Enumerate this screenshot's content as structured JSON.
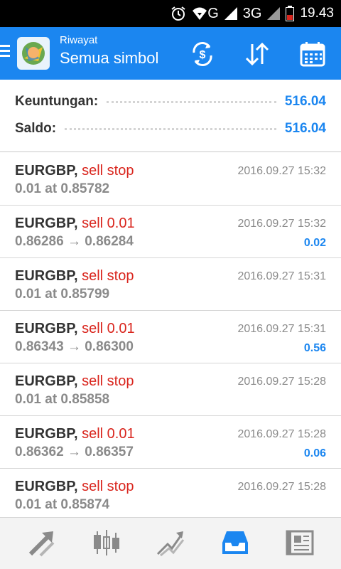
{
  "status_bar": {
    "network_label": "G",
    "network2_label": "3G",
    "time": "19.43"
  },
  "header": {
    "subtitle": "Riwayat",
    "title": "Semua simbol",
    "actions": [
      "exchange-icon",
      "sort-icon",
      "calendar-icon"
    ]
  },
  "summary": {
    "profit_label": "Keuntungan:",
    "profit_value": "516.04",
    "balance_label": "Saldo:",
    "balance_value": "516.04"
  },
  "history": [
    {
      "symbol": "EURGBP,",
      "type": "sell stop",
      "detail": "0.01 at 0.85782",
      "time": "2016.09.27 15:32",
      "profit": ""
    },
    {
      "symbol": "EURGBP,",
      "type": "sell 0.01",
      "detail": "0.86286 → 0.86284",
      "time": "2016.09.27 15:32",
      "profit": "0.02"
    },
    {
      "symbol": "EURGBP,",
      "type": "sell stop",
      "detail": "0.01 at 0.85799",
      "time": "2016.09.27 15:31",
      "profit": ""
    },
    {
      "symbol": "EURGBP,",
      "type": "sell 0.01",
      "detail": "0.86343 → 0.86300",
      "time": "2016.09.27 15:31",
      "profit": "0.56"
    },
    {
      "symbol": "EURGBP,",
      "type": "sell stop",
      "detail": "0.01 at 0.85858",
      "time": "2016.09.27 15:28",
      "profit": ""
    },
    {
      "symbol": "EURGBP,",
      "type": "sell 0.01",
      "detail": "0.86362 → 0.86357",
      "time": "2016.09.27 15:28",
      "profit": "0.06"
    },
    {
      "symbol": "EURGBP,",
      "type": "sell stop",
      "detail": "0.01 at 0.85874",
      "time": "2016.09.27 15:28",
      "profit": ""
    }
  ],
  "bottom_nav": {
    "items": [
      "quotes-icon",
      "chart-icon",
      "trade-icon",
      "history-icon",
      "news-icon"
    ],
    "active": "history-icon"
  },
  "colors": {
    "accent": "#1b86f0",
    "sell": "#d9251d",
    "muted": "#8a8a8a",
    "text": "#333333"
  }
}
